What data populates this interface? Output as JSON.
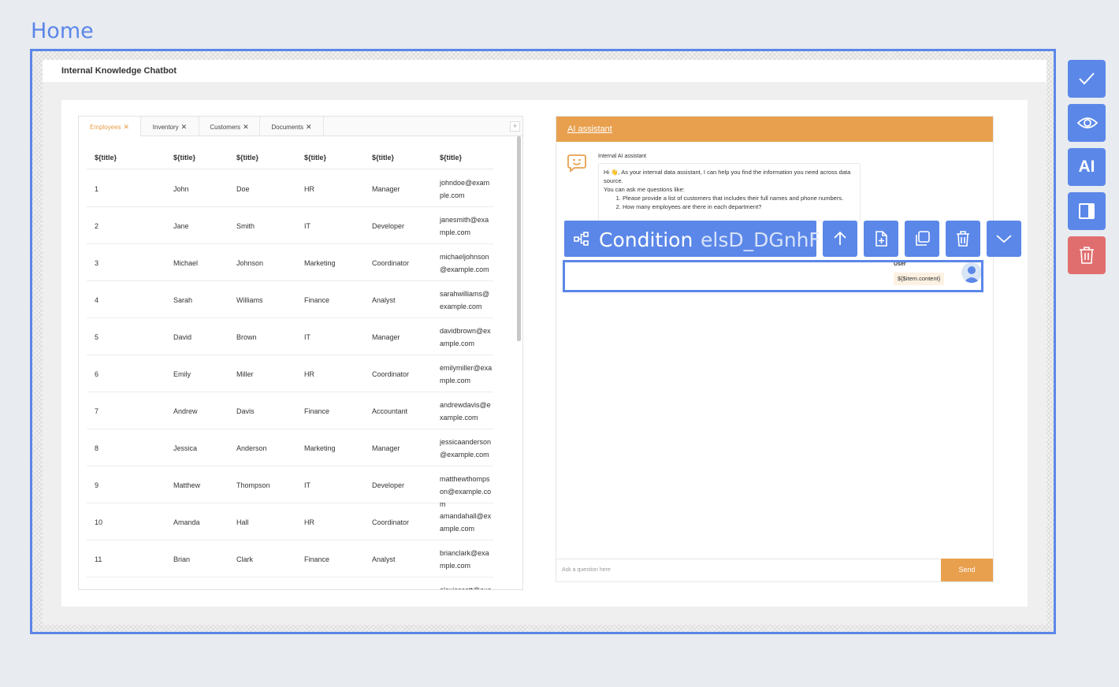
{
  "page": {
    "title": "Home"
  },
  "app": {
    "title": "Internal Knowledge Chatbot"
  },
  "tabs": [
    {
      "label": "Employees",
      "close": "✕",
      "active": true
    },
    {
      "label": "Inventory",
      "close": "✕",
      "active": false
    },
    {
      "label": "Customers",
      "close": "✕",
      "active": false
    },
    {
      "label": "Documents",
      "close": "✕",
      "active": false
    }
  ],
  "tab_add": "+",
  "table": {
    "headers": [
      "${title}",
      "${title}",
      "${title}",
      "${title}",
      "${title}",
      "${title}"
    ],
    "rows": [
      [
        "1",
        "John",
        "Doe",
        "HR",
        "Manager",
        "johndoe@example.com"
      ],
      [
        "2",
        "Jane",
        "Smith",
        "IT",
        "Developer",
        "janesmith@example.com"
      ],
      [
        "3",
        "Michael",
        "Johnson",
        "Marketing",
        "Coordinator",
        "michaeljohnson@example.com"
      ],
      [
        "4",
        "Sarah",
        "Williams",
        "Finance",
        "Analyst",
        "sarahwilliams@example.com"
      ],
      [
        "5",
        "David",
        "Brown",
        "IT",
        "Manager",
        "davidbrown@example.com"
      ],
      [
        "6",
        "Emily",
        "Miller",
        "HR",
        "Coordinator",
        "emilymiller@example.com"
      ],
      [
        "7",
        "Andrew",
        "Davis",
        "Finance",
        "Accountant",
        "andrewdavis@example.com"
      ],
      [
        "8",
        "Jessica",
        "Anderson",
        "Marketing",
        "Manager",
        "jessicaanderson@example.com"
      ],
      [
        "9",
        "Matthew",
        "Thompson",
        "IT",
        "Developer",
        "matthewthompson@example.com"
      ],
      [
        "10",
        "Amanda",
        "Hall",
        "HR",
        "Coordinator",
        "amandahall@example.com"
      ],
      [
        "11",
        "Brian",
        "Clark",
        "Finance",
        "Analyst",
        "brianclark@example.com"
      ],
      [
        "",
        "",
        "",
        "",
        "",
        "alexisscott@example.com"
      ]
    ]
  },
  "assistant": {
    "header": "AI assistant",
    "bot_name": "Internal AI assistant",
    "greeting": "Hi 👋, As your internal data assistant, I can help you find the information you need across data source.",
    "intro": "You can ask me questions like:",
    "examples": [
      "Please provide a list of customers that includes their full names and phone numbers.",
      "How many employees are there in each department?"
    ],
    "user_label": "User",
    "user_message": "${$item.content}",
    "input_placeholder": "Ask a question here",
    "send_label": "Send"
  },
  "selection": {
    "type_label": "Condition",
    "id": "elsD_DGnhF"
  },
  "side_toolbar": {
    "ai_label": "AI"
  },
  "colors": {
    "accent": "#5b87e8",
    "orange": "#e8a04e",
    "danger": "#e06e6e"
  }
}
